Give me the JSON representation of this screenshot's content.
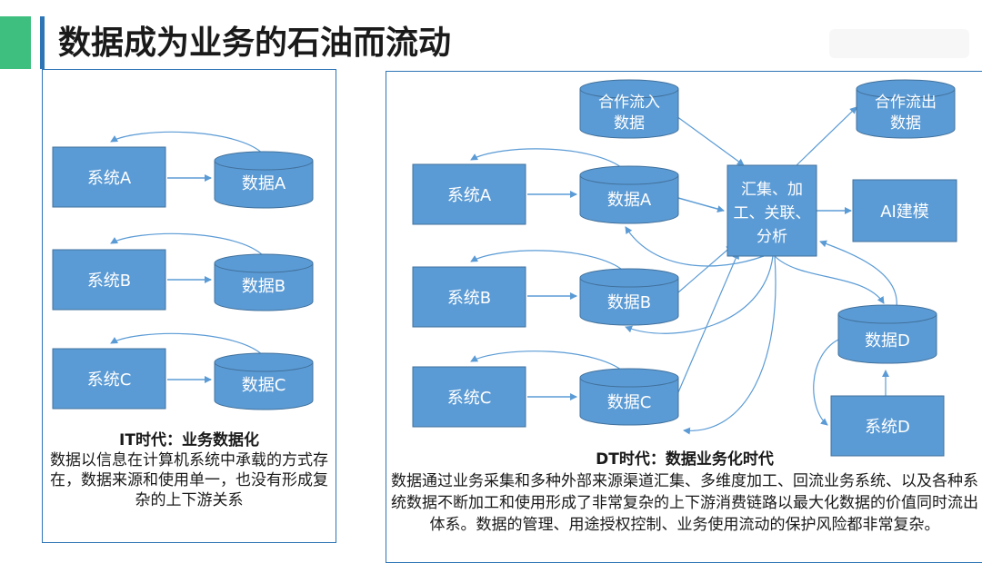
{
  "title": "数据成为业务的石油而流动",
  "left": {
    "nodes": {
      "sysA": "系统A",
      "dataA": "数据A",
      "sysB": "系统B",
      "dataB": "数据B",
      "sysC": "系统C",
      "dataC": "数据C"
    },
    "caption_title": "IT时代：业务数据化",
    "caption_body": "数据以信息在计算机系统中承载的方式存在，数据来源和使用单一，也没有形成复杂的上下游关系"
  },
  "right": {
    "nodes": {
      "sysA": "系统A",
      "dataA": "数据A",
      "sysB": "系统B",
      "dataB": "数据B",
      "sysC": "系统C",
      "dataC": "数据C",
      "coopIn1": "合作流入",
      "coopIn2": "数据",
      "coopOut1": "合作流出",
      "coopOut2": "数据",
      "hub1": "汇集、加",
      "hub2": "工、关联、",
      "hub3": "分析",
      "ai": "AI建模",
      "dataD": "数据D",
      "sysD": "系统D"
    },
    "caption_title": "DT时代：数据业务化时代",
    "caption_body": "数据通过业务采集和多种外部来源渠道汇集、多维度加工、回流业务系统、以及各种系统数据不断加工和使用形成了非常复杂的上下游消费链路以最大化数据的价值同时流出体系。数据的管理、用途授权控制、业务使用流动的保护风险都非常复杂。"
  },
  "colors": {
    "node_fill": "#5b9bd5",
    "node_stroke": "#41719c",
    "arrow": "#5b9bd5",
    "accent_green": "#3fbf7f",
    "accent_blue": "#2e75b6"
  }
}
